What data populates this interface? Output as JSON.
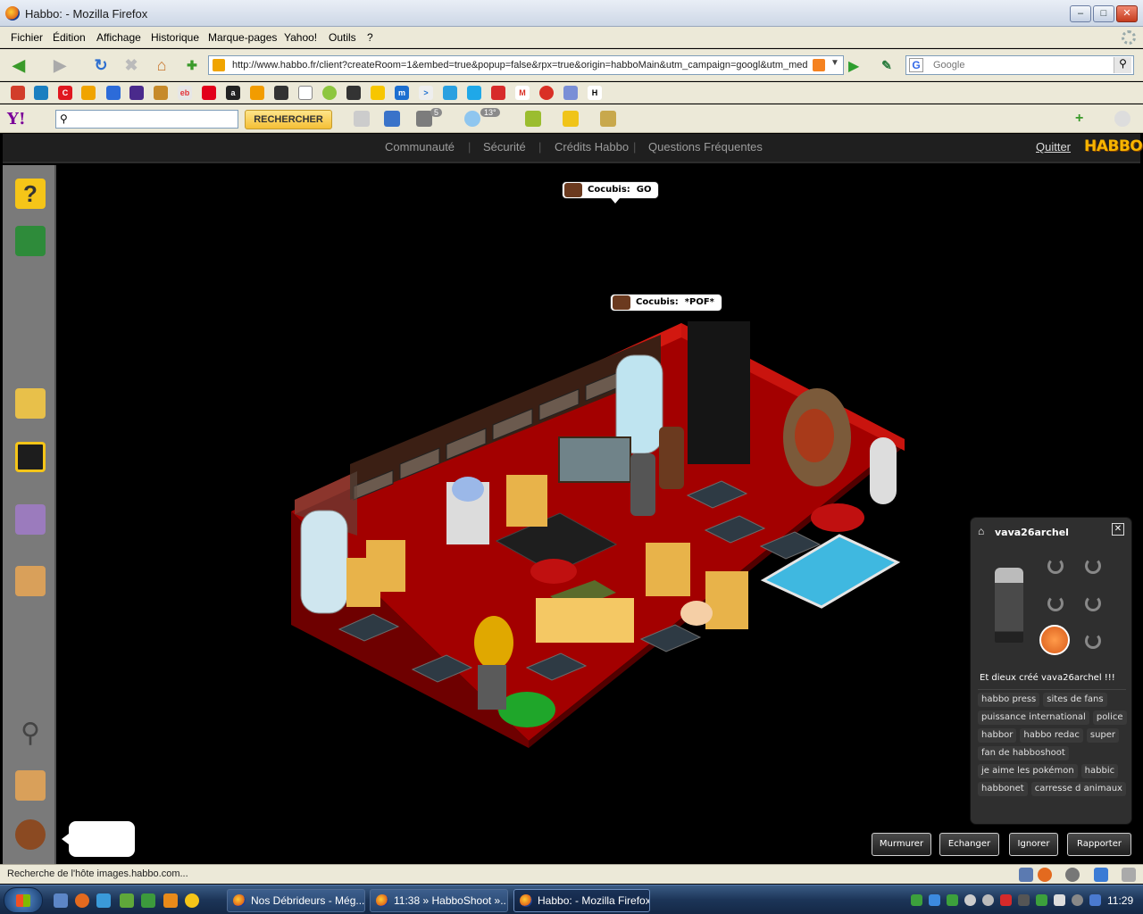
{
  "window": {
    "title": "Habbo: - Mozilla Firefox"
  },
  "menu": [
    "Fichier",
    "Édition",
    "Affichage",
    "Historique",
    "Marque-pages",
    "Yahoo!",
    "Outils",
    "?"
  ],
  "nav": {
    "url": "http://www.habbo.fr/client?createRoom=1&embed=true&popup=false&rpx=true&origin=habboMain&utm_campaign=googl&utm_med",
    "search_placeholder": "Google"
  },
  "yahoo": {
    "logo": "Y!",
    "button": "RECHERCHER",
    "mail_count": "5",
    "weather": "13°"
  },
  "habbo_nav": {
    "links": [
      "Communauté",
      "Sécurité",
      "Crédits Habbo",
      "Questions Fréquentes"
    ],
    "quit": "Quitter",
    "logo": "HABBO"
  },
  "chat": [
    {
      "user": "Cocubis:",
      "text": "GO"
    },
    {
      "user": "Cocubis:",
      "text": "*POF*"
    }
  ],
  "user_panel": {
    "name": "vava26archel",
    "motto": "Et dieux créé vava26archel !!!",
    "tags": [
      "habbo press",
      "sites de fans",
      "puissance international",
      "police",
      "habbor",
      "habbo redac",
      "super",
      "fan de habboshoot",
      "je aime les pokémon",
      "habbic",
      "habbonet",
      "carresse d animaux"
    ]
  },
  "actions": [
    "Murmurer",
    "Echanger",
    "Ignorer",
    "Rapporter"
  ],
  "status": {
    "text": "Recherche de l'hôte images.habbo.com..."
  },
  "taskbar": {
    "tasks": [
      "Nos Débrideurs - Még...",
      "11:38 » HabboShoot »...",
      "Habbo: - Mozilla Firefox"
    ],
    "clock": "11:29"
  },
  "colors": {
    "room_floor": "#a30000",
    "room_wall": "#c9140e",
    "habbo_logo": "#f7b500",
    "panel_bg": "#2f2f2f"
  }
}
